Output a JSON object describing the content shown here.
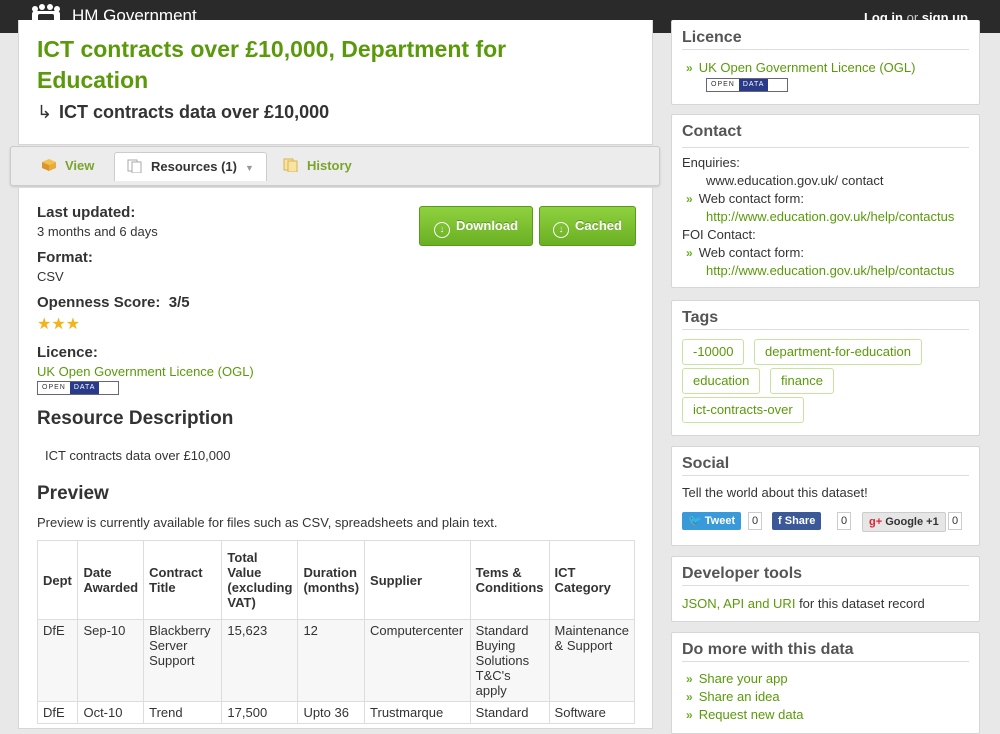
{
  "topbar": {
    "gov_label": "HM Government",
    "login": "Log in",
    "or": "or",
    "signup": "sign up"
  },
  "dataset": {
    "title": "ICT contracts over £10,000, Department for Education",
    "subtitle": "ICT contracts data over £10,000"
  },
  "tabs": [
    {
      "label": "View"
    },
    {
      "label": "Resources (1)"
    },
    {
      "label": "History"
    }
  ],
  "resource": {
    "last_updated_label": "Last updated:",
    "last_updated_value": "3 months and 6 days",
    "format_label": "Format:",
    "format_value": "CSV",
    "openness_label": "Openness Score:",
    "openness_value": "3/5",
    "stars": 3,
    "licence_label": "Licence:",
    "licence_value": "UK Open Government Licence (OGL)",
    "download_label": "Download",
    "cached_label": "Cached",
    "description_heading": "Resource Description",
    "description": "ICT contracts data over £10,000",
    "preview_heading": "Preview",
    "preview_note": "Preview is currently available for files such as CSV, spreadsheets and plain text."
  },
  "badge": {
    "open": "OPEN",
    "data": "DATA"
  },
  "table": {
    "headers": [
      "Dept",
      "Date Awarded",
      "Contract Title",
      "Total Value (excluding VAT)",
      "Duration (months)",
      "Supplier",
      "Tems & Conditions",
      "ICT Category"
    ],
    "rows": [
      [
        "DfE",
        "Sep-10",
        "Blackberry Server Support",
        "15,623",
        "12",
        "Computercenter",
        "Standard Buying Solutions T&C's apply",
        "Maintenance & Support"
      ],
      [
        "DfE",
        "Oct-10",
        "Trend",
        "17,500",
        "Upto 36",
        "Trustmarque",
        "Standard",
        "Software"
      ]
    ]
  },
  "sidebar": {
    "licence": {
      "heading": "Licence",
      "link": "UK Open Government Licence (OGL)"
    },
    "contact": {
      "heading": "Contact",
      "enquiries_label": "Enquiries:",
      "enquiries_value": "www.education.gov.uk/ contact",
      "web_form_label": "Web contact form:",
      "web_form_url": "http://www.education.gov.uk/help/contactus",
      "foi_label": "FOI Contact:",
      "foi_web_form_label": "Web contact form:",
      "foi_web_form_url": "http://www.education.gov.uk/help/contactus"
    },
    "tags": {
      "heading": "Tags",
      "items": [
        "-10000",
        "department-for-education",
        "education",
        "finance",
        "ict-contracts-over"
      ]
    },
    "social": {
      "heading": "Social",
      "text": "Tell the world about this dataset!",
      "tweet": "Tweet",
      "tweet_count": "0",
      "share": "Share",
      "share_count": "0",
      "gplus": "Google +1",
      "gplus_count": "0"
    },
    "devtools": {
      "heading": "Developer tools",
      "link": "JSON, API and URI",
      "text": "for this dataset record"
    },
    "more": {
      "heading": "Do more with this data",
      "items": [
        "Share your app",
        "Share an idea",
        "Request new data"
      ]
    }
  },
  "colors": {
    "accent": "#6ab023",
    "topbar": "#2a2a2a",
    "twitter": "#3a9ad9",
    "facebook": "#3b5998",
    "gplus": "#d9d9d9"
  }
}
